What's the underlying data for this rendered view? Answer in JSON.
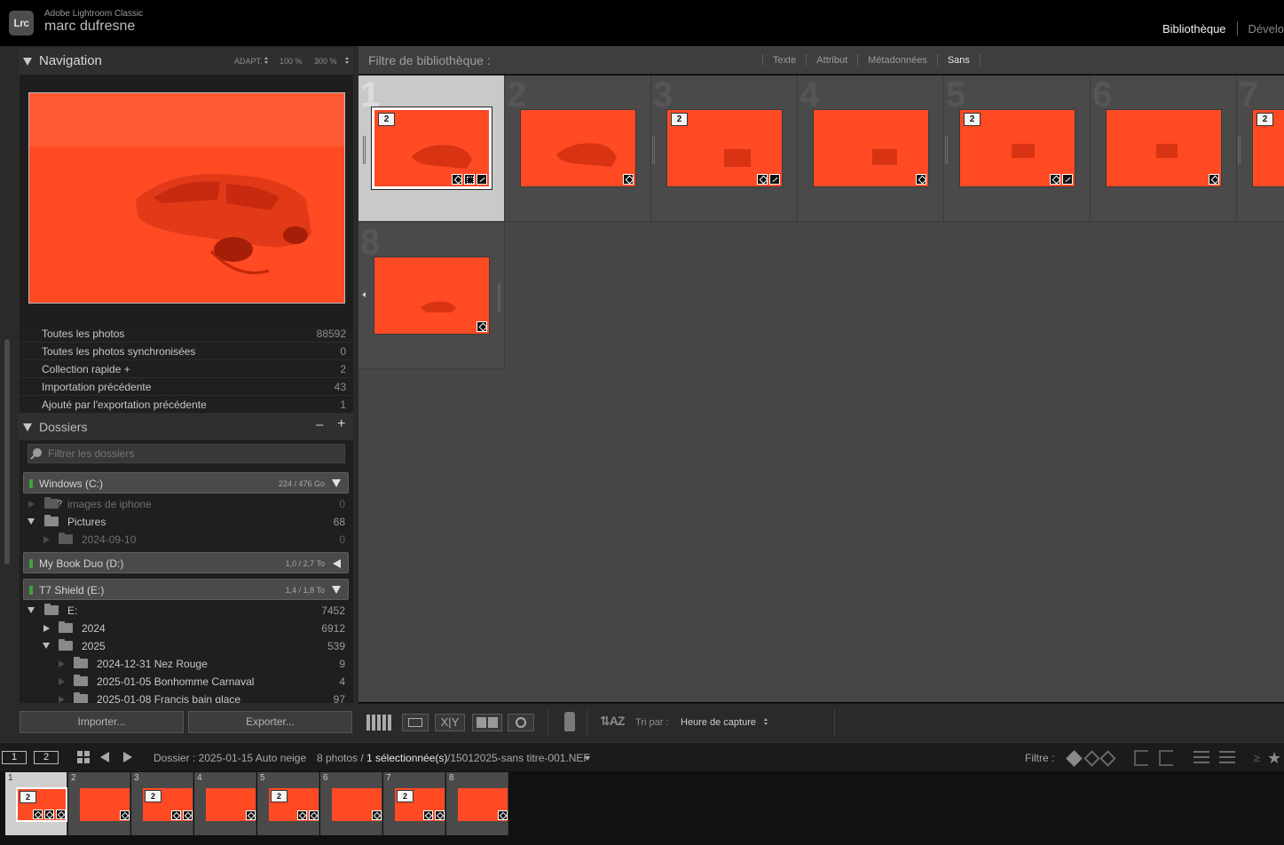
{
  "app": {
    "name": "Adobe Lightroom Classic",
    "logo": "Lrc",
    "user": "marc dufresne",
    "modules": [
      {
        "label": "Bibliothèque",
        "active": true
      },
      {
        "label": "Dévelo",
        "active": false
      }
    ]
  },
  "navigator": {
    "title": "Navigation",
    "zoom_fit": "ADAPT.",
    "zoom_100": "100 %",
    "zoom_300": "300 %"
  },
  "catalog_items": [
    {
      "label": "Toutes les photos",
      "count": "88592"
    },
    {
      "label": "Toutes les photos synchronisées",
      "count": "0"
    },
    {
      "label": "Collection rapide +",
      "count": "2"
    },
    {
      "label": "Importation précédente",
      "count": "43"
    },
    {
      "label": "Ajouté par l'exportation précédente",
      "count": "1"
    }
  ],
  "folders": {
    "title": "Dossiers",
    "minus": "–",
    "plus": "+",
    "filter_placeholder": "Filtrer les dossiers",
    "volumes": [
      {
        "name": "Windows (C:)",
        "size": "224 / 476 Go",
        "expanded": true
      },
      {
        "name": "My Book Duo (D:)",
        "size": "1,0 / 2,7 To",
        "expanded": false
      },
      {
        "name": "T7 Shield (E:)",
        "size": "1,4 / 1,8 To",
        "expanded": true
      }
    ],
    "c_items": [
      {
        "name": "images de iphone",
        "count": "0",
        "missing": "?"
      },
      {
        "name": "Pictures",
        "count": "68"
      },
      {
        "name": "2024-09-10",
        "count": "0"
      }
    ],
    "e_items": [
      {
        "name": "E:",
        "count": "7452"
      },
      {
        "name": "2024",
        "count": "6912"
      },
      {
        "name": "2025",
        "count": "539"
      },
      {
        "name": "2024-12-31 Nez Rouge",
        "count": "9"
      },
      {
        "name": "2025-01-05 Bonhomme Carnaval",
        "count": "4"
      },
      {
        "name": "2025-01-08 Francis bain glace",
        "count": "97"
      }
    ]
  },
  "buttons": {
    "import": "Importer...",
    "export": "Exporter..."
  },
  "filter_bar": {
    "title": "Filtre de bibliothèque :",
    "options": [
      "Texte",
      "Attribut",
      "Métadonnées",
      "Sans"
    ],
    "active": "Sans"
  },
  "grid": {
    "cells": [
      {
        "num": "1",
        "badge": "2",
        "selected": true
      },
      {
        "num": "2",
        "badge": ""
      },
      {
        "num": "3",
        "badge": "2"
      },
      {
        "num": "4",
        "badge": ""
      },
      {
        "num": "5",
        "badge": "2"
      },
      {
        "num": "6",
        "badge": ""
      },
      {
        "num": "7",
        "badge": "2"
      },
      {
        "num": "8",
        "badge": ""
      }
    ]
  },
  "toolbar": {
    "sort_label": "Tri par :",
    "sort_value": "Heure de capture"
  },
  "filmstrip_bar": {
    "screen1": "1",
    "screen2": "2",
    "folder_label": "Dossier : 2025-01-15 Auto neige",
    "photos": "8 photos /",
    "selected": "1 sélectionnée(s)",
    "filename": "/15012025-sans titre-001.NEF",
    "filter_label": "Filtre :",
    "rating_op": "≥"
  },
  "filmstrip": {
    "cells": [
      {
        "num": "1",
        "badge": "2"
      },
      {
        "num": "2",
        "badge": ""
      },
      {
        "num": "3",
        "badge": "2"
      },
      {
        "num": "4",
        "badge": ""
      },
      {
        "num": "5",
        "badge": "2"
      },
      {
        "num": "6",
        "badge": ""
      },
      {
        "num": "7",
        "badge": "2"
      },
      {
        "num": "8",
        "badge": ""
      }
    ]
  },
  "colors": {
    "photo": "#ff4a24",
    "panel": "#2a2a2a",
    "grid_bg": "#464646"
  }
}
